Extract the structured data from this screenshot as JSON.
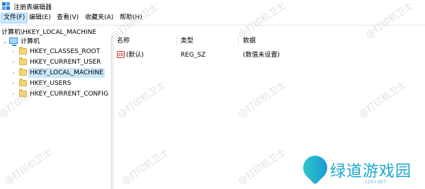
{
  "window": {
    "title": "注册表编辑器"
  },
  "menu": [
    {
      "label": "文件(F)",
      "active": true
    },
    {
      "label": "编辑(E)"
    },
    {
      "label": "查看(V)"
    },
    {
      "label": "收藏夹(A)"
    },
    {
      "label": "帮助(H)"
    }
  ],
  "address": {
    "path": "计算机\\HKEY_LOCAL_MACHINE"
  },
  "tree": {
    "root": "计算机",
    "items": [
      {
        "label": "HKEY_CLASSES_ROOT"
      },
      {
        "label": "HKEY_CURRENT_USER"
      },
      {
        "label": "HKEY_LOCAL_MACHINE",
        "selected": true
      },
      {
        "label": "HKEY_USERS"
      },
      {
        "label": "HKEY_CURRENT_CONFIG"
      }
    ]
  },
  "list": {
    "columns": [
      "名称",
      "类型",
      "数据"
    ],
    "rows": [
      {
        "name": "(默认)",
        "type": "REG_SZ",
        "data": "(数值未设置)"
      }
    ]
  },
  "watermark": {
    "text": "@打印机卫士"
  },
  "brand": {
    "text": "绿道游戏园",
    "sub": "LDYX.NET"
  },
  "colors": {
    "selection": "#cce8ff",
    "folder": "#f5d477",
    "brand": "#18a7d0"
  }
}
